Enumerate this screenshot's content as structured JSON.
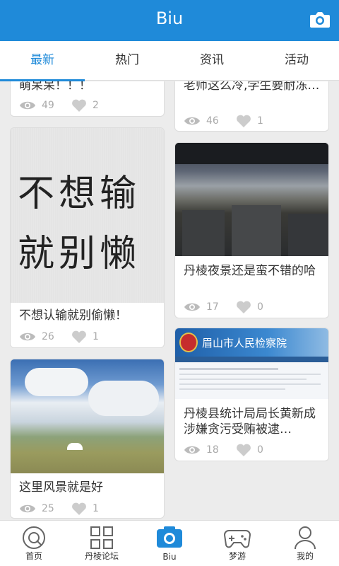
{
  "header": {
    "title": "Biu",
    "camera_icon": "camera-icon"
  },
  "tabs": [
    {
      "label": "最新",
      "active": true
    },
    {
      "label": "热门",
      "active": false
    },
    {
      "label": "资讯",
      "active": false
    },
    {
      "label": "活动",
      "active": false
    }
  ],
  "cards": [
    {
      "caption": "萌呆呆！！！",
      "views": "49",
      "likes": "2"
    },
    {
      "caption": "老师这么冷,学生要耐冻…",
      "views": "46",
      "likes": "1"
    },
    {
      "caption": "不想认输就别偷懒！",
      "views": "26",
      "likes": "1",
      "image_text_1": "不想输",
      "image_text_2": "就别懒"
    },
    {
      "caption": "丹棱夜景还是蛮不错的哈",
      "views": "17",
      "likes": "0"
    },
    {
      "caption": "这里风景就是好",
      "views": "25",
      "likes": "1"
    },
    {
      "caption": "丹棱县统计局局长黄新成涉嫌贪污受贿被逮…",
      "views": "18",
      "likes": "0",
      "image_title": "眉山市人民检察院"
    }
  ],
  "bottom_nav": [
    {
      "label": "首页",
      "icon": "home-icon",
      "active": false
    },
    {
      "label": "丹棱论坛",
      "icon": "grid-icon",
      "active": false
    },
    {
      "label": "Biu",
      "icon": "camera-icon",
      "active": true
    },
    {
      "label": "梦游",
      "icon": "gamepad-icon",
      "active": false
    },
    {
      "label": "我的",
      "icon": "user-icon",
      "active": false
    }
  ],
  "colors": {
    "brand": "#1f8ad9",
    "muted": "#aaaaaa"
  }
}
